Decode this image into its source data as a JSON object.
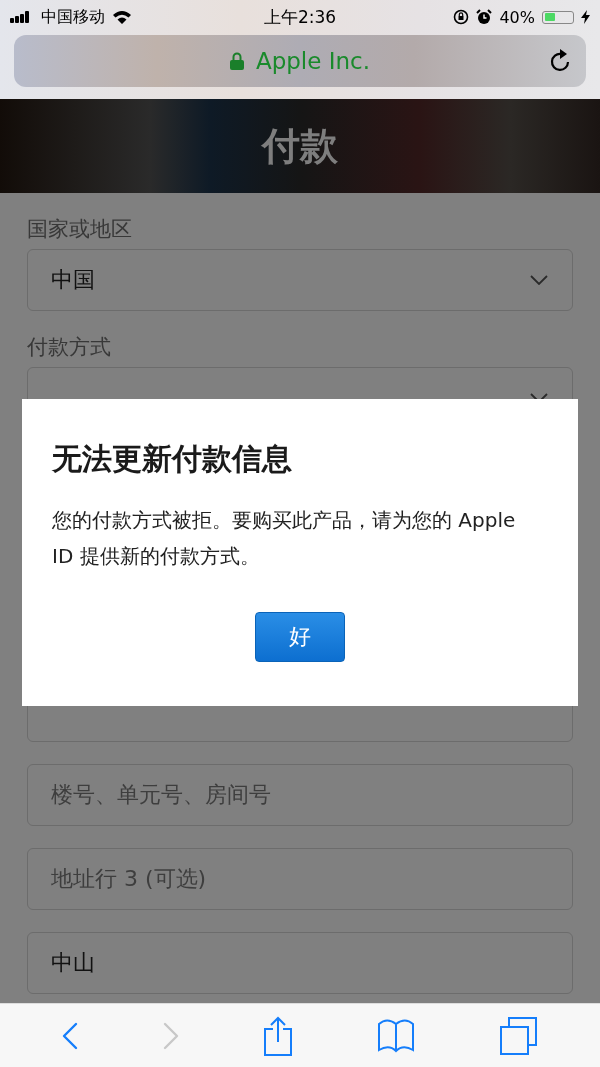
{
  "status_bar": {
    "carrier": "中国移动",
    "time": "上午2:36",
    "battery_text": "40%",
    "battery": {
      "level": 0.4
    }
  },
  "url_bar": {
    "site": "Apple Inc.",
    "secure": true
  },
  "header": {
    "title": "付款"
  },
  "form": [
    {
      "kind": "label",
      "text": "国家或地区"
    },
    {
      "kind": "select",
      "value": "中国"
    },
    {
      "kind": "label",
      "text": "付款方式"
    },
    {
      "kind": "select"
    },
    {
      "kind": "hidden"
    },
    {
      "kind": "field"
    },
    {
      "kind": "field",
      "placeholder": "楼号、单元号、房间号"
    },
    {
      "kind": "field",
      "placeholder": "地址行 3 (可选)"
    },
    {
      "kind": "field",
      "value": "中山"
    }
  ],
  "dialog": {
    "title": "无法更新付款信息",
    "message": "您的付款方式被拒。要购买此产品，请为您的 Apple ID 提供新的付款方式。",
    "button": "好"
  },
  "toolbar": [
    {
      "kind": "back",
      "disabled": false
    },
    {
      "kind": "forward",
      "disabled": true
    },
    {
      "kind": "share",
      "disabled": false
    },
    {
      "kind": "bookmarks",
      "disabled": false
    },
    {
      "kind": "tabs",
      "disabled": false
    }
  ]
}
